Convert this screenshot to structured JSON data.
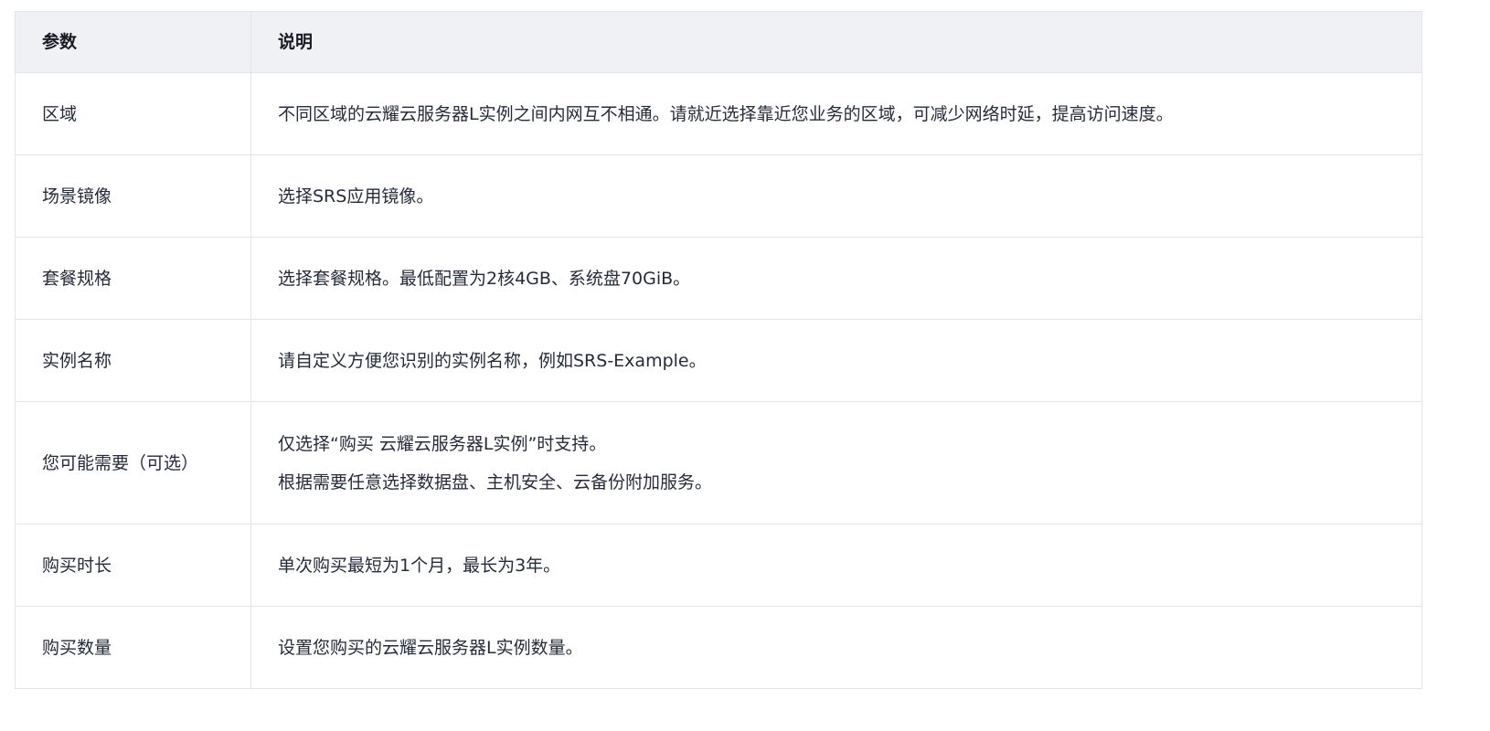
{
  "table": {
    "headers": [
      "参数",
      "说明"
    ],
    "rows": [
      {
        "param": "区域",
        "desc": [
          "不同区域的云耀云服务器L实例之间内网互不相通。请就近选择靠近您业务的区域，可减少网络时延，提高访问速度。"
        ]
      },
      {
        "param": "场景镜像",
        "desc": [
          "选择SRS应用镜像。"
        ]
      },
      {
        "param": "套餐规格",
        "desc": [
          "选择套餐规格。最低配置为2核4GB、系统盘70GiB。"
        ]
      },
      {
        "param": "实例名称",
        "desc": [
          "请自定义方便您识别的实例名称，例如SRS-Example。"
        ]
      },
      {
        "param": "您可能需要（可选）",
        "desc": [
          "仅选择“购买 云耀云服务器L实例”时支持。",
          "根据需要任意选择数据盘、主机安全、云备份附加服务。"
        ]
      },
      {
        "param": "购买时长",
        "desc": [
          "单次购买最短为1个月，最长为3年。"
        ]
      },
      {
        "param": "购买数量",
        "desc": [
          "设置您购买的云耀云服务器L实例数量。"
        ]
      }
    ]
  }
}
